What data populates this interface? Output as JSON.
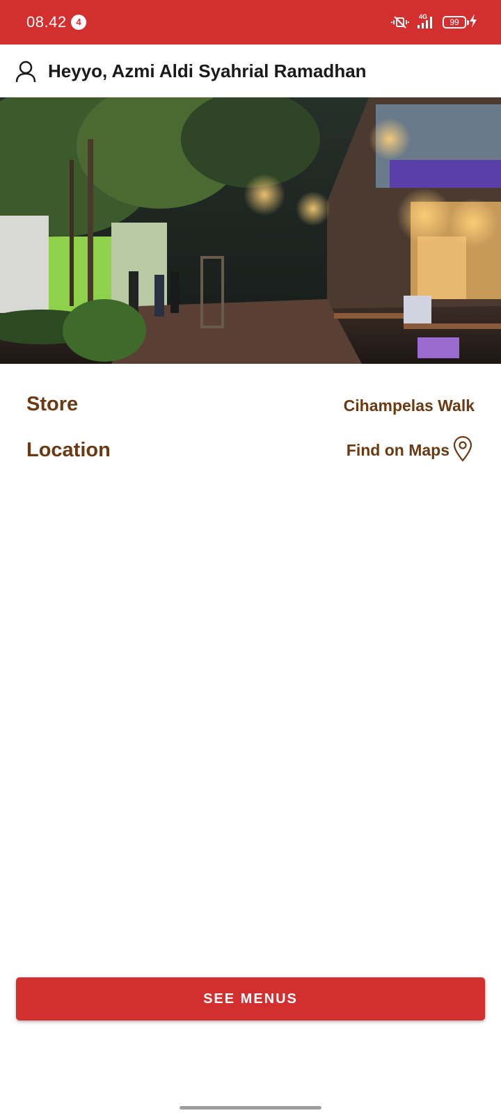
{
  "status_bar": {
    "time": "08.42",
    "notification_count": "4",
    "network": "4G",
    "battery": "99",
    "icons": [
      "vibrate-mute-icon",
      "signal-icon",
      "battery-icon",
      "charging-icon"
    ],
    "background_color": "#d32f2f"
  },
  "header": {
    "greeting": "Heyyo, Azmi Aldi Syahrial Ramadhan",
    "icon": "user-icon"
  },
  "hero": {
    "description": "store-photo"
  },
  "info": {
    "store_label": "Store",
    "store_value": "Cihampelas Walk",
    "location_label": "Location",
    "location_link": "Find on Maps",
    "location_icon": "map-pin-icon"
  },
  "actions": {
    "see_menus": "SEE MENUS"
  },
  "colors": {
    "accent": "#d32f2f",
    "label_brown": "#6b3a12"
  }
}
